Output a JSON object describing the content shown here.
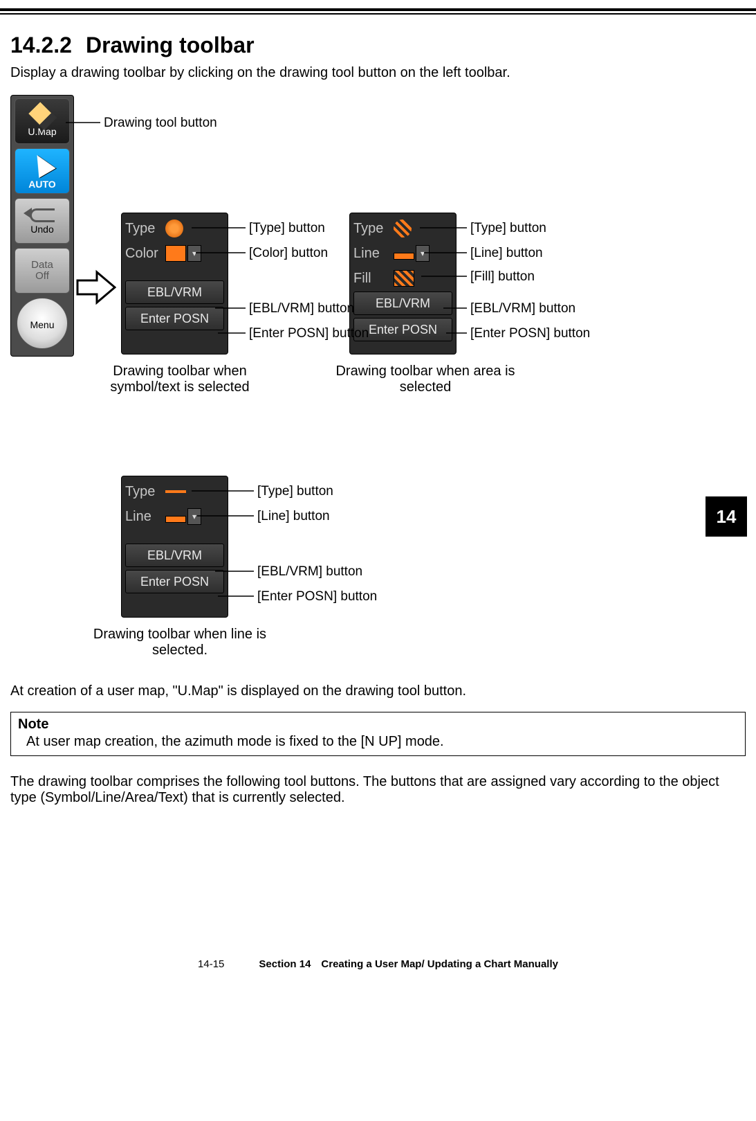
{
  "section_number": "14.2.2",
  "section_title": "Drawing toolbar",
  "intro": "Display a drawing toolbar by clicking on the drawing tool button on the left toolbar.",
  "left_toolbar": {
    "umap_label": "U.Map",
    "auto_label": "AUTO",
    "undo_label": "Undo",
    "dataoff_label_1": "Data",
    "dataoff_label_2": "Off",
    "menu_label": "Menu"
  },
  "labels": {
    "drawing_tool_button": "Drawing tool button",
    "type_btn": "[Type] button",
    "color_btn": "[Color] button",
    "line_btn": "[Line] button",
    "fill_btn": "[Fill] button",
    "ebl_vrm_btn": "[EBL/VRM] button",
    "enter_posn_btn": "[Enter POSN] button"
  },
  "panel_text": {
    "type": "Type",
    "color": "Color",
    "line": "Line",
    "fill": "Fill",
    "ebl_vrm": "EBL/VRM",
    "enter_posn": "Enter POSN"
  },
  "captions": {
    "symbol": "Drawing toolbar when symbol/text is selected",
    "area": "Drawing toolbar when area is selected",
    "line": "Drawing toolbar when line is selected."
  },
  "chapter_tab": "14",
  "para_after_diagrams": "At creation of a user map, \"U.Map\" is displayed on the drawing tool button.",
  "note": {
    "title": "Note",
    "body": "At user map creation, the azimuth mode is fixed to the [N UP] mode."
  },
  "para_final": "The drawing toolbar comprises the following tool buttons. The buttons that are assigned vary according to the object type (Symbol/Line/Area/Text) that is currently selected.",
  "footer": {
    "page": "14-15",
    "section": "Section 14 Creating a User Map/ Updating a Chart Manually"
  }
}
